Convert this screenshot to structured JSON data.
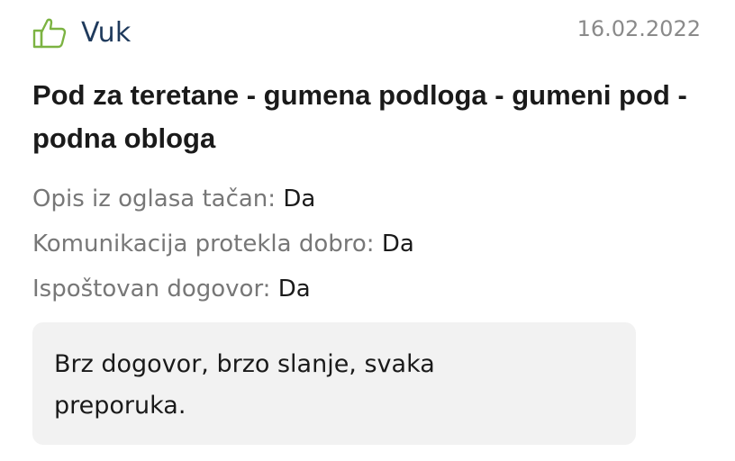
{
  "review": {
    "author": "Vuk",
    "date": "16.02.2022",
    "sentiment_icon": "thumbs-up-icon",
    "icon_color": "#7cb342",
    "title": "Pod za teretane - gumena podloga - gumeni pod - podna obloga",
    "ratings": [
      {
        "label": "Opis iz oglasa tačan:",
        "value": "Da"
      },
      {
        "label": "Komunikacija protekla dobro:",
        "value": "Da"
      },
      {
        "label": "Ispoštovan dogovor:",
        "value": "Da"
      }
    ],
    "comment": "Brz dogovor, brzo slanje, svaka preporuka."
  }
}
